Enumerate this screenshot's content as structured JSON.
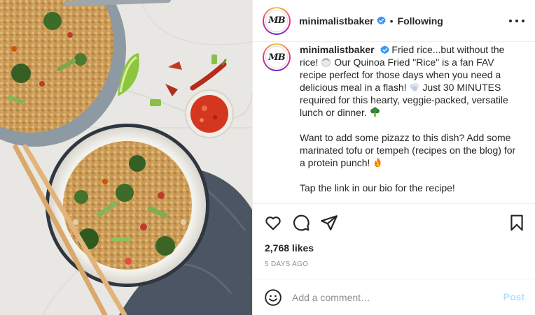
{
  "post": {
    "username": "minimalistbaker",
    "avatar_initials": "MB",
    "separator": "•",
    "follow_status": "Following",
    "more_icon": "more-horizontal-icon"
  },
  "caption": {
    "username": "minimalistbaker",
    "line1": "Fried rice...but without the rice!",
    "line2": "Our Quinoa Fried \"Rice\" is a fan FAV recipe perfect for those days when you need a delicious meal in a flash!",
    "line3": "Just 30 MINUTES required for this hearty, veggie-packed, versatile lunch or dinner.",
    "para2": "Want to add some pizazz to this dish? Add some marinated tofu or tempeh (recipes on the blog) for a protein punch!",
    "para3": "Tap the link in our bio for the recipe!",
    "emojis": [
      "rice-ball-emoji",
      "dash-emoji",
      "broccoli-emoji",
      "fire-emoji"
    ]
  },
  "actions": {
    "like_icon": "heart-icon",
    "comment_icon": "comment-icon",
    "share_icon": "send-icon",
    "save_icon": "bookmark-icon"
  },
  "likes": "2,768 likes",
  "date": "5 DAYS AGO",
  "comment": {
    "placeholder": "Add a comment…",
    "emoji_icon": "smiley-icon",
    "post_label": "Post"
  },
  "colors": {
    "text": "#262626",
    "muted": "#8e8e8e",
    "border": "#efefef",
    "post_disabled": "#b2dffc",
    "verified": "#3897f0"
  }
}
